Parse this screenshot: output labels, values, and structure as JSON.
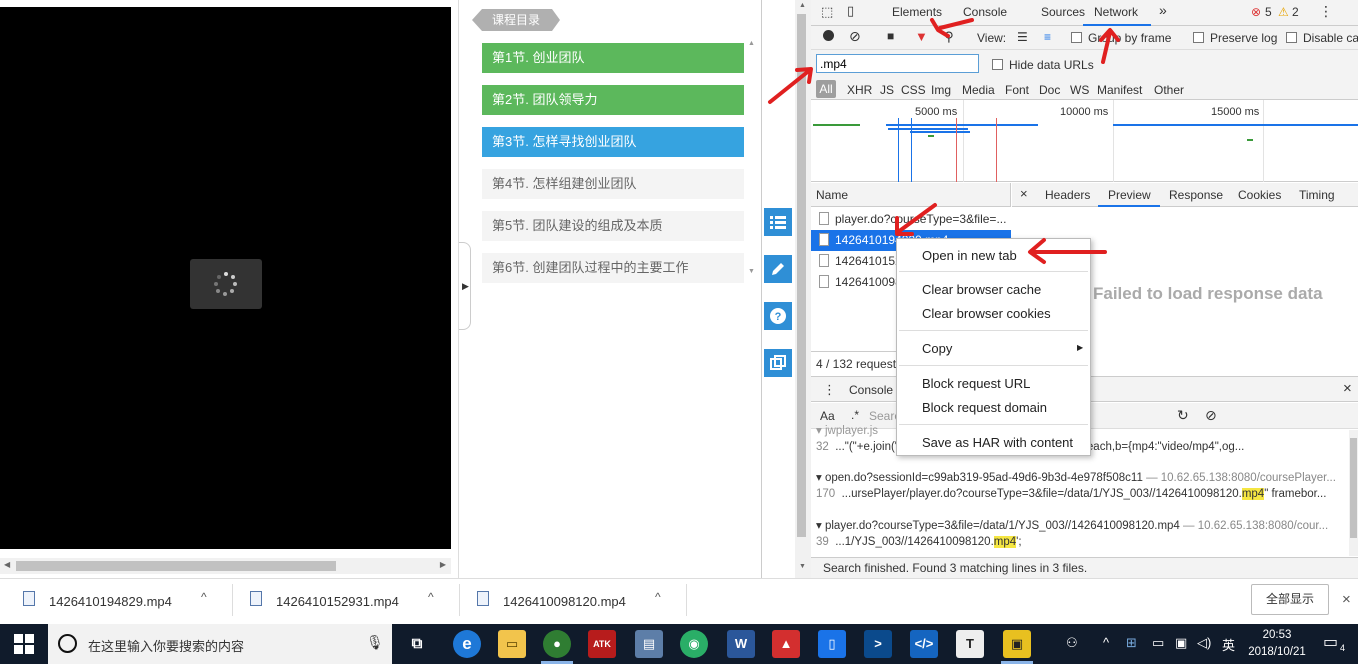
{
  "course": {
    "catalog_label": "课程目录",
    "lessons": [
      {
        "label": "第1节. 创业团队",
        "state": "done"
      },
      {
        "label": "第2节. 团队领导力",
        "state": "done"
      },
      {
        "label": "第3节. 怎样寻找创业团队",
        "state": "active"
      },
      {
        "label": "第4节. 怎样组建创业团队",
        "state": "todo"
      },
      {
        "label": "第5节. 团队建设的组成及本质",
        "state": "todo"
      },
      {
        "label": "第6节. 创建团队过程中的主要工作",
        "state": "todo"
      }
    ],
    "side_tools": [
      "list-icon",
      "edit-icon",
      "help-icon",
      "copy-icon"
    ]
  },
  "devtools": {
    "tabs": [
      "Elements",
      "Console",
      "Sources",
      "Network"
    ],
    "active_tab": "Network",
    "more": "»",
    "errors": "5",
    "warnings": "2",
    "menu": "⋮",
    "toolbar": {
      "view_label": "View:",
      "group_by_frame": "Group by frame",
      "preserve_log": "Preserve log",
      "disable_cache": "Disable cache"
    },
    "filter_value": ".mp4",
    "hide_data_urls": "Hide data URLs",
    "types": [
      "All",
      "XHR",
      "JS",
      "CSS",
      "Img",
      "Media",
      "Font",
      "Doc",
      "WS",
      "Manifest",
      "Other"
    ],
    "timeline_ticks": [
      "5000 ms",
      "10000 ms",
      "15000 ms"
    ],
    "name_header": "Name",
    "requests": [
      "player.do?courseType=3&file=...",
      "1426410194829.mp4",
      "1426410152931.mp4",
      "1426410098120.mp4"
    ],
    "detail_close": "×",
    "detail_tabs": [
      "Headers",
      "Preview",
      "Response",
      "Cookies",
      "Timing"
    ],
    "active_detail": "Preview",
    "failed_msg": "Failed to load response data",
    "status": "4 / 132 requests",
    "drawer_tab": "Console",
    "drawer_close": "×",
    "search_aa": "Aa",
    "search_regex": ".*",
    "search_placeholder": "Search",
    "results": {
      "file0": "jwplayer.js",
      "r0_line": "32",
      "r0_text": "...\"(\"+e.join(\"\")+\")\";return c};var ...jwplayer._.l=f.foreach,b={mp4:\"video/mp4\",og...",
      "file1_name": "open.do?sessionId=c99ab319-95ad-49d6-9b3d-4e978f508c11",
      "file1_src": " — 10.62.65.138:8080/coursePlayer...",
      "r1_line": "170",
      "r1_pre": "...ursePlayer/player.do?courseType=3&file=/data/1/YJS_003//1426410098120.",
      "r1_hl": "mp4",
      "r1_post": "\" framebor...",
      "file2_name": "player.do?courseType=3&file=/data/1/YJS_003//1426410098120.mp4",
      "file2_src": " — 10.62.65.138:8080/cour...",
      "r2_line": "39",
      "r2_pre": "...1/YJS_003//1426410098120.",
      "r2_hl": "mp4",
      "r2_post": "';"
    },
    "search_status": "Search finished.  Found 3 matching lines in 3 files."
  },
  "context_menu": {
    "items": [
      "Open in new tab",
      "Clear browser cache",
      "Clear browser cookies",
      "Copy",
      "Block request URL",
      "Block request domain",
      "Save as HAR with content"
    ],
    "copy_arrow": "▶"
  },
  "downloads": {
    "files": [
      "1426410194829.mp4",
      "1426410152931.mp4",
      "1426410098120.mp4"
    ],
    "chevron": "^",
    "show_all": "全部显示",
    "close": "×"
  },
  "taskbar": {
    "search_placeholder": "在这里输入你要搜索的内容",
    "time": "20:53",
    "date": "2018/10/21",
    "ime": "英",
    "notification_count": "4",
    "atk_label": "ATK"
  },
  "colors": {
    "annotation": "#e02020",
    "selection": "#1a73e8",
    "lesson_done": "#5cb85c",
    "lesson_active": "#36a3e0"
  }
}
